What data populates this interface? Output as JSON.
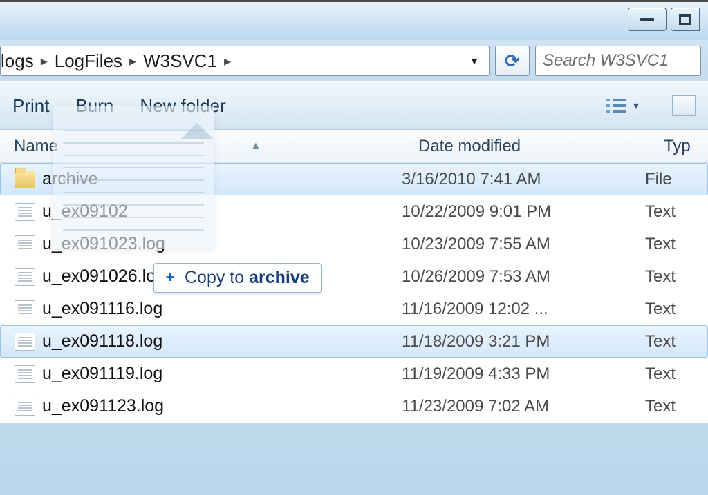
{
  "breadcrumb": [
    "logs",
    "LogFiles",
    "W3SVC1"
  ],
  "search_placeholder": "Search W3SVC1",
  "toolbar": {
    "print": "Print",
    "burn": "Burn",
    "new_folder": "New folder"
  },
  "columns": {
    "name": "Name",
    "date": "Date modified",
    "type": "Typ"
  },
  "rows": [
    {
      "name": "archive",
      "date": "3/16/2010 7:41 AM",
      "type": "File",
      "kind": "folder",
      "selected": true
    },
    {
      "name": "u_ex09102",
      "date": "10/22/2009 9:01 PM",
      "type": "Text",
      "kind": "file",
      "selected": false,
      "truncated": true
    },
    {
      "name": "u_ex091023.log",
      "date": "10/23/2009 7:55 AM",
      "type": "Text",
      "kind": "file",
      "selected": false
    },
    {
      "name": "u_ex091026.log",
      "date": "10/26/2009 7:53 AM",
      "type": "Text",
      "kind": "file",
      "selected": false
    },
    {
      "name": "u_ex091116.log",
      "date": "11/16/2009 12:02 ...",
      "type": "Text",
      "kind": "file",
      "selected": false
    },
    {
      "name": "u_ex091118.log",
      "date": "11/18/2009 3:21 PM",
      "type": "Text",
      "kind": "file",
      "selected": true
    },
    {
      "name": "u_ex091119.log",
      "date": "11/19/2009 4:33 PM",
      "type": "Text",
      "kind": "file",
      "selected": false
    },
    {
      "name": "u_ex091123.log",
      "date": "11/23/2009 7:02 AM",
      "type": "Text",
      "kind": "file",
      "selected": false
    }
  ],
  "drag_tooltip": {
    "prefix": "Copy to ",
    "target": "archive"
  },
  "glyphs": {
    "sep": "▸",
    "dropdown": "▾",
    "refresh": "⟳",
    "sort_asc": "▲"
  }
}
